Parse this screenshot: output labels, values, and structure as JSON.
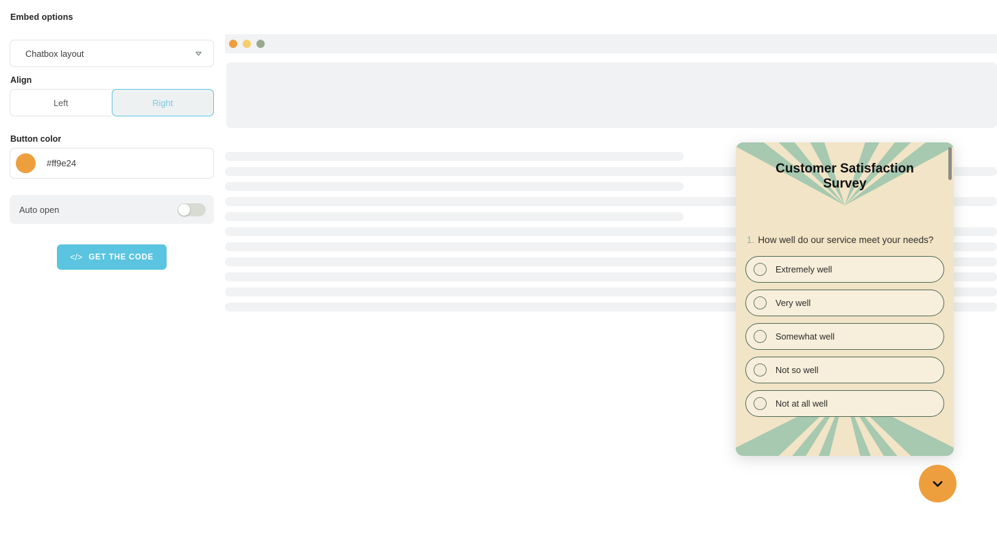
{
  "header": {
    "title": "Embed options",
    "close_icon": "close-icon"
  },
  "panel": {
    "layout_select": {
      "value": "Chatbox layout",
      "chevron_icon": "chevron-down-icon"
    },
    "align": {
      "label": "Align",
      "options": [
        {
          "label": "Left",
          "selected": false
        },
        {
          "label": "Right",
          "selected": true
        }
      ]
    },
    "button_color": {
      "label": "Button color",
      "value": "#ff9e24",
      "swatch_color": "#ed9f3e"
    },
    "auto_open": {
      "label": "Auto open",
      "state": "off"
    },
    "cta": {
      "label": "GET THE CODE",
      "icon": "code-icon",
      "icon_glyph": "</>",
      "color": "#5bc4e0"
    }
  },
  "preview": {
    "browser_dots": [
      {
        "name": "close-dot",
        "color": "#ed9f3e"
      },
      {
        "name": "minimize-dot",
        "color": "#f6ce6a"
      },
      {
        "name": "maximize-dot",
        "color": "#9aa890"
      }
    ],
    "skeleton_lines": [
      "short",
      "full",
      "short",
      "full",
      "short",
      "full",
      "full",
      "full",
      "full",
      "full",
      "full"
    ]
  },
  "survey": {
    "title": "Customer Satisfaction Survey",
    "question_number": "1.",
    "question": "How well do our service meet your needs?",
    "options": [
      {
        "label": "Extremely well",
        "selected": false
      },
      {
        "label": "Very well",
        "selected": false
      },
      {
        "label": "Somewhat well",
        "selected": false
      },
      {
        "label": "Not so well",
        "selected": false
      },
      {
        "label": "Not at all well",
        "selected": false
      }
    ],
    "card_color": "#f2e4c6",
    "ray_color": "#a6c9b0",
    "fab": {
      "icon": "chevron-down-icon",
      "color": "#ed9f3e"
    }
  }
}
